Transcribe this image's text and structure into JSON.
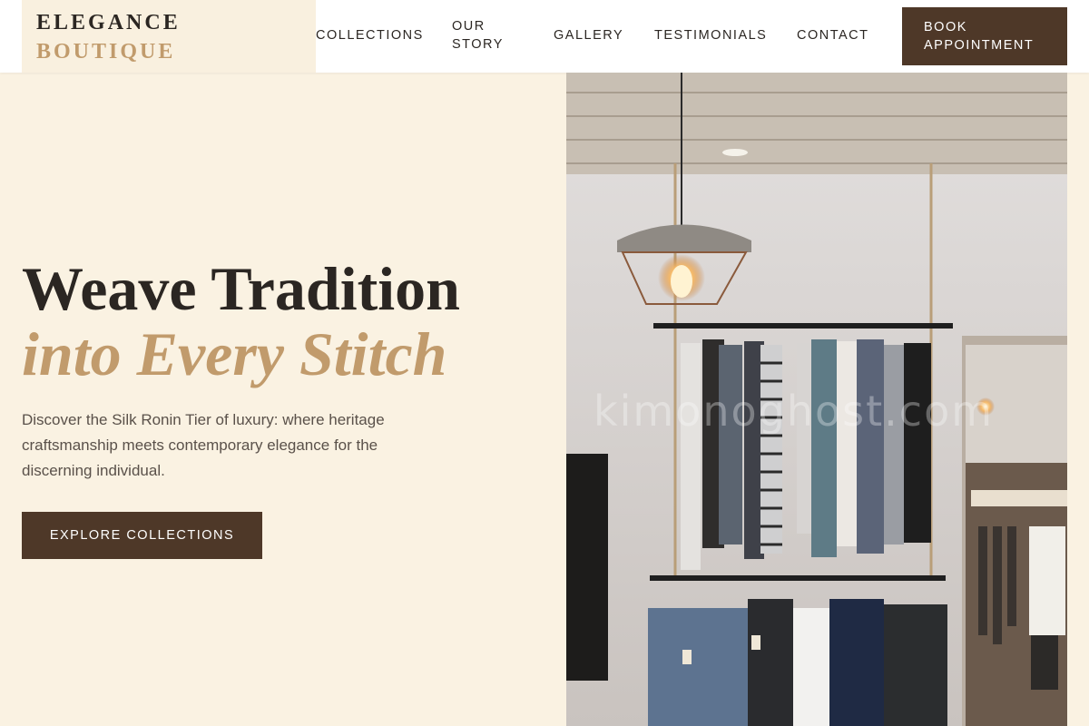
{
  "brand": {
    "line1": "ELEGANCE",
    "line2": "BOUTIQUE"
  },
  "nav": {
    "items": [
      {
        "label": "COLLECTIONS"
      },
      {
        "label": "OUR STORY"
      },
      {
        "label": "GALLERY"
      },
      {
        "label": "TESTIMONIALS"
      },
      {
        "label": "CONTACT"
      }
    ],
    "cta_label": "BOOK APPOINTMENT"
  },
  "hero": {
    "title_line1": "Weave Tradition",
    "title_line2": "into Every Stitch",
    "subtitle": "Discover the Silk Ronin Tier of luxury: where heritage craftsmanship meets contemporary elegance for the discerning individual.",
    "cta_label": "EXPLORE COLLECTIONS",
    "image_watermark": "kimonoghost.com"
  },
  "colors": {
    "background": "#faf2e2",
    "header": "#ffffff",
    "logo_panel": "#f9f0df",
    "text_dark": "#2b2622",
    "accent_gold": "#c19b6c",
    "button_brown": "#4e3828",
    "body_text": "#5a514a"
  },
  "icons": [
    "pendant-lamp-icon",
    "clothing-rack-image"
  ]
}
